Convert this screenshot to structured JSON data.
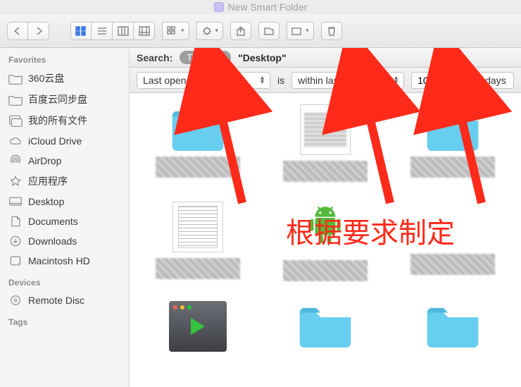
{
  "window": {
    "title": "New Smart Folder"
  },
  "sidebar": {
    "sections": [
      {
        "label": "Favorites",
        "items": [
          {
            "label": "360云盘",
            "icon": "folder-icon"
          },
          {
            "label": "百度云同步盘",
            "icon": "folder-icon"
          },
          {
            "label": "我的所有文件",
            "icon": "allfiles-icon"
          },
          {
            "label": "iCloud Drive",
            "icon": "cloud-icon"
          },
          {
            "label": "AirDrop",
            "icon": "airdrop-icon"
          },
          {
            "label": "应用程序",
            "icon": "apps-icon"
          },
          {
            "label": "Desktop",
            "icon": "desktop-icon"
          },
          {
            "label": "Documents",
            "icon": "documents-icon"
          },
          {
            "label": "Downloads",
            "icon": "downloads-icon"
          },
          {
            "label": "Macintosh HD",
            "icon": "hdd-icon"
          }
        ]
      },
      {
        "label": "Devices",
        "items": [
          {
            "label": "Remote Disc",
            "icon": "disc-icon"
          }
        ]
      },
      {
        "label": "Tags",
        "items": []
      }
    ]
  },
  "search": {
    "label": "Search:",
    "scope_active": "This Mac",
    "scope_other": "\"Desktop\""
  },
  "criteria": {
    "attribute": "Last opened date",
    "relation_label": "is",
    "relation_value": "within last",
    "number": "10",
    "unit": "days"
  },
  "annotation": {
    "text": "根据要求制定"
  },
  "colors": {
    "accent_red": "#ff2a1a",
    "folder_blue": "#67cef0"
  }
}
